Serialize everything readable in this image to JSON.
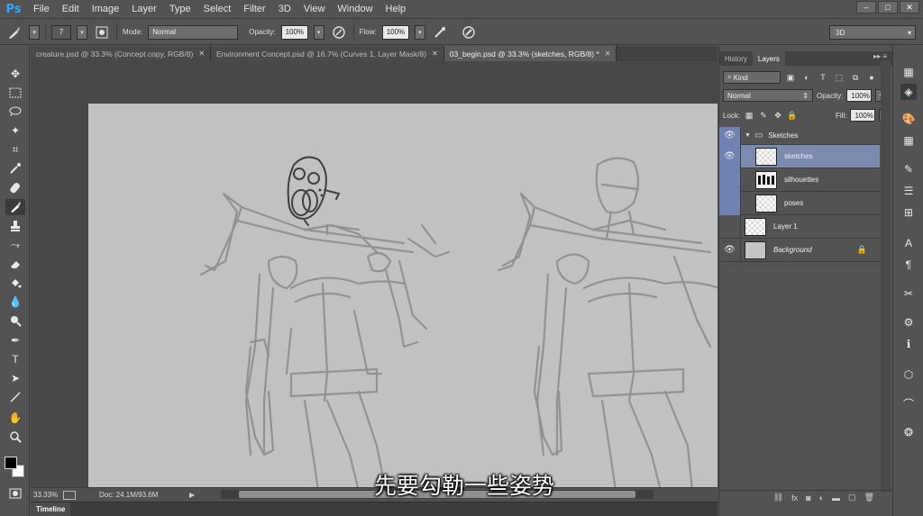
{
  "app": {
    "logo": "Ps"
  },
  "menu": [
    "File",
    "Edit",
    "Image",
    "Layer",
    "Type",
    "Select",
    "Filter",
    "3D",
    "View",
    "Window",
    "Help"
  ],
  "window_controls": [
    "–",
    "□",
    "✕"
  ],
  "options": {
    "brush_size": "7",
    "mode_label": "Mode:",
    "mode_value": "Normal",
    "opacity_label": "Opacity:",
    "opacity_value": "100%",
    "flow_label": "Flow:",
    "flow_value": "100%",
    "workspace": "3D"
  },
  "tabs": [
    {
      "label": "creature.psd @ 33.3% (Concept copy, RGB/8)",
      "active": false
    },
    {
      "label": "Environment Concept.psd @ 16.7% (Curves 1, Layer Mask/8)",
      "active": false
    },
    {
      "label": "03_begin.psd @ 33.3% (sketches, RGB/8) *",
      "active": true
    }
  ],
  "status": {
    "zoom": "33.33%",
    "doc": "Doc: 24.1M/93.6M"
  },
  "timeline": {
    "label": "Timeline"
  },
  "subtitle": "先要勾勒一些姿势",
  "panel": {
    "tabs": [
      "History",
      "Layers"
    ],
    "active_tab": "Layers",
    "kind": "Kind",
    "blend_mode": "Normal",
    "opacity_label": "Opacity:",
    "opacity_value": "100%",
    "lock_label": "Lock:",
    "fill_label": "Fill:",
    "fill_value": "100%",
    "layers": [
      {
        "name": "Sketches",
        "type": "group",
        "visible": true
      },
      {
        "name": "sketches",
        "type": "layer",
        "visible": true,
        "selected": true
      },
      {
        "name": "silhouettes",
        "type": "layer",
        "visible": false
      },
      {
        "name": "poses",
        "type": "layer",
        "visible": false
      },
      {
        "name": "Layer 1",
        "type": "layer",
        "visible": false
      },
      {
        "name": "Background",
        "type": "background",
        "visible": true,
        "locked": true
      }
    ]
  },
  "colors": {
    "ui_bg": "#535353",
    "canvas_bg": "#c1c1c1",
    "selection": "#7b8bb0",
    "ps_blue": "#31a8ff"
  }
}
